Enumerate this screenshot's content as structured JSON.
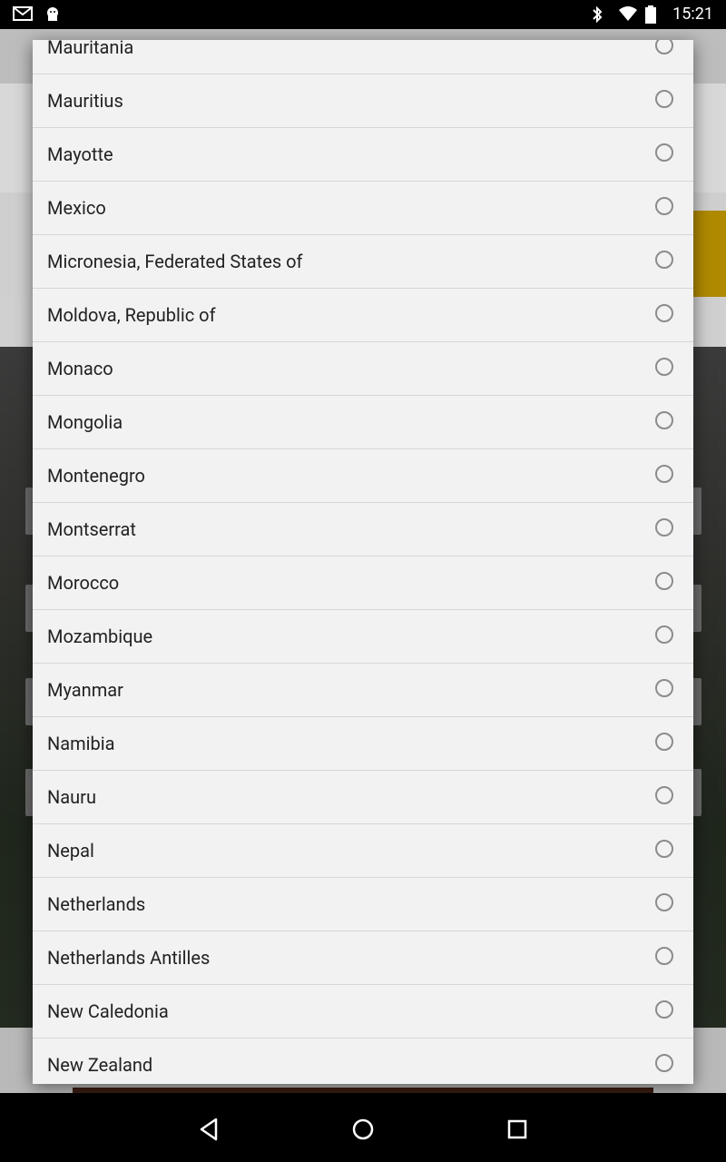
{
  "status_bar": {
    "time": "15:21",
    "icons_left": [
      "gmail-icon",
      "android-icon"
    ],
    "icons_right": [
      "bluetooth-icon",
      "wifi-icon",
      "battery-icon"
    ]
  },
  "country_list": {
    "items": [
      {
        "label": "Mauritania",
        "selected": false
      },
      {
        "label": "Mauritius",
        "selected": false
      },
      {
        "label": "Mayotte",
        "selected": false
      },
      {
        "label": "Mexico",
        "selected": false
      },
      {
        "label": "Micronesia, Federated States of",
        "selected": false
      },
      {
        "label": "Moldova, Republic of",
        "selected": false
      },
      {
        "label": "Monaco",
        "selected": false
      },
      {
        "label": "Mongolia",
        "selected": false
      },
      {
        "label": "Montenegro",
        "selected": false
      },
      {
        "label": "Montserrat",
        "selected": false
      },
      {
        "label": "Morocco",
        "selected": false
      },
      {
        "label": "Mozambique",
        "selected": false
      },
      {
        "label": "Myanmar",
        "selected": false
      },
      {
        "label": "Namibia",
        "selected": false
      },
      {
        "label": "Nauru",
        "selected": false
      },
      {
        "label": "Nepal",
        "selected": false
      },
      {
        "label": "Netherlands",
        "selected": false
      },
      {
        "label": "Netherlands Antilles",
        "selected": false
      },
      {
        "label": "New Caledonia",
        "selected": false
      },
      {
        "label": "New Zealand",
        "selected": false
      }
    ]
  },
  "nav_bar": {
    "buttons": [
      "back-icon",
      "home-icon",
      "recents-icon"
    ]
  },
  "colors": {
    "dialog_bg": "#f2f2f2",
    "divider": "#d6d6d6",
    "radio_border": "#8c8c8c",
    "text": "#222222"
  }
}
